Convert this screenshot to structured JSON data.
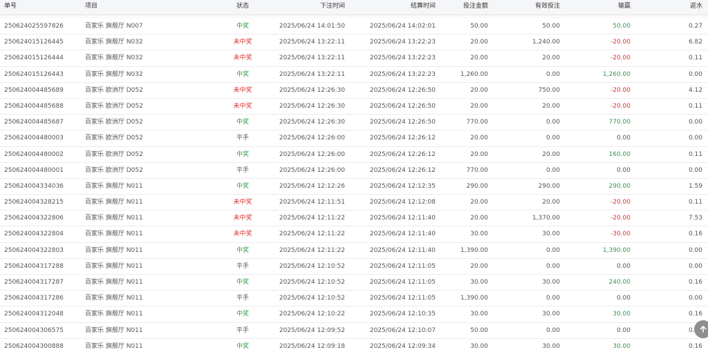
{
  "colors": {
    "win": "#2e9c48",
    "lose": "#d9342b",
    "neutral": "#555555"
  },
  "table": {
    "headers": {
      "id": "单号",
      "item": "项目",
      "status": "状态",
      "bet_time": "下注时间",
      "settle_time": "结算时间",
      "amount": "投注金额",
      "valid": "有效投注",
      "win_loss": "输赢",
      "rebate": "返水"
    },
    "rows": [
      {
        "id": "250624025597826",
        "item": "百家乐 旗舰厅 N007",
        "status": "中奖",
        "status_type": "win",
        "bet_time": "2025/06/24 14:01:50",
        "settle_time": "2025/06/24 14:02:01",
        "amount": "50.00",
        "valid": "50.00",
        "win_loss": "50.00",
        "win_type": "win",
        "rebate": "0.27"
      },
      {
        "id": "250624015126445",
        "item": "百家乐 旗舰厅 N032",
        "status": "未中奖",
        "status_type": "lose",
        "bet_time": "2025/06/24 13:22:11",
        "settle_time": "2025/06/24 13:22:23",
        "amount": "20.00",
        "valid": "1,240.00",
        "win_loss": "-20.00",
        "win_type": "lose",
        "rebate": "6.82"
      },
      {
        "id": "250624015126444",
        "item": "百家乐 旗舰厅 N032",
        "status": "未中奖",
        "status_type": "lose",
        "bet_time": "2025/06/24 13:22:11",
        "settle_time": "2025/06/24 13:22:23",
        "amount": "20.00",
        "valid": "20.00",
        "win_loss": "-20.00",
        "win_type": "lose",
        "rebate": "0.11"
      },
      {
        "id": "250624015126443",
        "item": "百家乐 旗舰厅 N032",
        "status": "中奖",
        "status_type": "win",
        "bet_time": "2025/06/24 13:22:11",
        "settle_time": "2025/06/24 13:22:23",
        "amount": "1,260.00",
        "valid": "0.00",
        "win_loss": "1,260.00",
        "win_type": "win",
        "rebate": "0.00"
      },
      {
        "id": "250624004485689",
        "item": "百家乐 欧洲厅 D052",
        "status": "未中奖",
        "status_type": "lose",
        "bet_time": "2025/06/24 12:26:30",
        "settle_time": "2025/06/24 12:26:50",
        "amount": "20.00",
        "valid": "750.00",
        "win_loss": "-20.00",
        "win_type": "lose",
        "rebate": "4.12"
      },
      {
        "id": "250624004485688",
        "item": "百家乐 欧洲厅 D052",
        "status": "未中奖",
        "status_type": "lose",
        "bet_time": "2025/06/24 12:26:30",
        "settle_time": "2025/06/24 12:26:50",
        "amount": "20.00",
        "valid": "20.00",
        "win_loss": "-20.00",
        "win_type": "lose",
        "rebate": "0.11"
      },
      {
        "id": "250624004485687",
        "item": "百家乐 欧洲厅 D052",
        "status": "中奖",
        "status_type": "win",
        "bet_time": "2025/06/24 12:26:30",
        "settle_time": "2025/06/24 12:26:50",
        "amount": "770.00",
        "valid": "0.00",
        "win_loss": "770.00",
        "win_type": "win",
        "rebate": "0.00"
      },
      {
        "id": "250624004480003",
        "item": "百家乐 欧洲厅 D052",
        "status": "平手",
        "status_type": "neutral",
        "bet_time": "2025/06/24 12:26:00",
        "settle_time": "2025/06/24 12:26:12",
        "amount": "20.00",
        "valid": "0.00",
        "win_loss": "0.00",
        "win_type": "neutral",
        "rebate": "0.00"
      },
      {
        "id": "250624004480002",
        "item": "百家乐 欧洲厅 D052",
        "status": "中奖",
        "status_type": "win",
        "bet_time": "2025/06/24 12:26:00",
        "settle_time": "2025/06/24 12:26:12",
        "amount": "20.00",
        "valid": "20.00",
        "win_loss": "160.00",
        "win_type": "win",
        "rebate": "0.11"
      },
      {
        "id": "250624004480001",
        "item": "百家乐 欧洲厅 D052",
        "status": "平手",
        "status_type": "neutral",
        "bet_time": "2025/06/24 12:26:00",
        "settle_time": "2025/06/24 12:26:12",
        "amount": "770.00",
        "valid": "0.00",
        "win_loss": "0.00",
        "win_type": "neutral",
        "rebate": "0.00"
      },
      {
        "id": "250624004334036",
        "item": "百家乐 旗舰厅 N011",
        "status": "中奖",
        "status_type": "win",
        "bet_time": "2025/06/24 12:12:26",
        "settle_time": "2025/06/24 12:12:35",
        "amount": "290.00",
        "valid": "290.00",
        "win_loss": "290.00",
        "win_type": "win",
        "rebate": "1.59"
      },
      {
        "id": "250624004328215",
        "item": "百家乐 旗舰厅 N011",
        "status": "未中奖",
        "status_type": "lose",
        "bet_time": "2025/06/24 12:11:51",
        "settle_time": "2025/06/24 12:12:08",
        "amount": "20.00",
        "valid": "20.00",
        "win_loss": "-20.00",
        "win_type": "lose",
        "rebate": "0.11"
      },
      {
        "id": "250624004322806",
        "item": "百家乐 旗舰厅 N011",
        "status": "未中奖",
        "status_type": "lose",
        "bet_time": "2025/06/24 12:11:22",
        "settle_time": "2025/06/24 12:11:40",
        "amount": "20.00",
        "valid": "1,370.00",
        "win_loss": "-20.00",
        "win_type": "lose",
        "rebate": "7.53"
      },
      {
        "id": "250624004322804",
        "item": "百家乐 旗舰厅 N011",
        "status": "未中奖",
        "status_type": "lose",
        "bet_time": "2025/06/24 12:11:22",
        "settle_time": "2025/06/24 12:11:40",
        "amount": "30.00",
        "valid": "30.00",
        "win_loss": "-30.00",
        "win_type": "lose",
        "rebate": "0.16"
      },
      {
        "id": "250624004322803",
        "item": "百家乐 旗舰厅 N011",
        "status": "中奖",
        "status_type": "win",
        "bet_time": "2025/06/24 12:11:22",
        "settle_time": "2025/06/24 12:11:40",
        "amount": "1,390.00",
        "valid": "0.00",
        "win_loss": "1,390.00",
        "win_type": "win",
        "rebate": "0.00"
      },
      {
        "id": "250624004317288",
        "item": "百家乐 旗舰厅 N011",
        "status": "平手",
        "status_type": "neutral",
        "bet_time": "2025/06/24 12:10:52",
        "settle_time": "2025/06/24 12:11:05",
        "amount": "20.00",
        "valid": "0.00",
        "win_loss": "0.00",
        "win_type": "neutral",
        "rebate": "0.00"
      },
      {
        "id": "250624004317287",
        "item": "百家乐 旗舰厅 N011",
        "status": "中奖",
        "status_type": "win",
        "bet_time": "2025/06/24 12:10:52",
        "settle_time": "2025/06/24 12:11:05",
        "amount": "30.00",
        "valid": "30.00",
        "win_loss": "240.00",
        "win_type": "win",
        "rebate": "0.16"
      },
      {
        "id": "250624004317286",
        "item": "百家乐 旗舰厅 N011",
        "status": "平手",
        "status_type": "neutral",
        "bet_time": "2025/06/24 12:10:52",
        "settle_time": "2025/06/24 12:11:05",
        "amount": "1,390.00",
        "valid": "0.00",
        "win_loss": "0.00",
        "win_type": "neutral",
        "rebate": "0.00"
      },
      {
        "id": "250624004312048",
        "item": "百家乐 旗舰厅 N011",
        "status": "中奖",
        "status_type": "win",
        "bet_time": "2025/06/24 12:10:22",
        "settle_time": "2025/06/24 12:10:35",
        "amount": "30.00",
        "valid": "30.00",
        "win_loss": "30.00",
        "win_type": "win",
        "rebate": "0.16"
      },
      {
        "id": "250624004306575",
        "item": "百家乐 旗舰厅 N011",
        "status": "平手",
        "status_type": "neutral",
        "bet_time": "2025/06/24 12:09:52",
        "settle_time": "2025/06/24 12:10:07",
        "amount": "50.00",
        "valid": "0.00",
        "win_loss": "0.00",
        "win_type": "neutral",
        "rebate": "0.00"
      },
      {
        "id": "250624004300888",
        "item": "百家乐 旗舰厅 N011",
        "status": "中奖",
        "status_type": "win",
        "bet_time": "2025/06/24 12:09:18",
        "settle_time": "2025/06/24 12:09:34",
        "amount": "30.00",
        "valid": "30.00",
        "win_loss": "30.00",
        "win_type": "win",
        "rebate": "0.16"
      }
    ]
  },
  "scroll_top_icon": "arrow-up-icon"
}
